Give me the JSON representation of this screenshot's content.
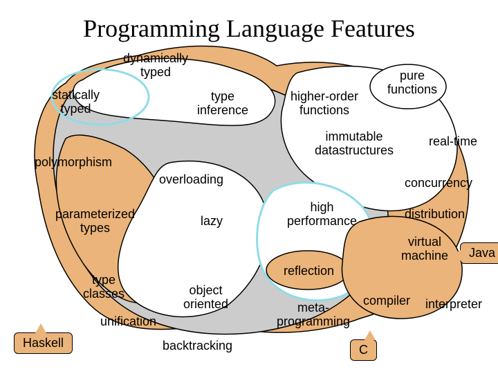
{
  "title": "Programming Language Features",
  "labels": {
    "dynamically_typed": "dynamically\ntyped",
    "statically_typed": "statically\ntyped",
    "type_inference": "type\ninference",
    "higher_order_functions": "higher-order\nfunctions",
    "pure_functions": "pure\nfunctions",
    "immutable_datastructures": "immutable\ndatastructures",
    "real_time": "real-time",
    "polymorphism": "polymorphism",
    "overloading": "overloading",
    "concurrency": "concurrency",
    "parameterized_types": "parameterized\ntypes",
    "lazy": "lazy",
    "high_performance": "high\nperformance",
    "distribution": "distribution",
    "virtual_machine": "virtual\nmachine",
    "reflection": "reflection",
    "type_classes": "type\nclasses",
    "object_oriented": "object\noriented",
    "compiler": "compiler",
    "interpreter": "interpreter",
    "unification": "unification",
    "metaprogramming": "meta-\nprogramming",
    "backtracking": "backtracking"
  },
  "callouts": {
    "haskell": "Haskell",
    "c": "C",
    "java": "Java"
  },
  "colors": {
    "orange": "#ebb47a",
    "gray": "#cccccc",
    "white": "#ffffff",
    "cyan": "#8fdce8"
  }
}
